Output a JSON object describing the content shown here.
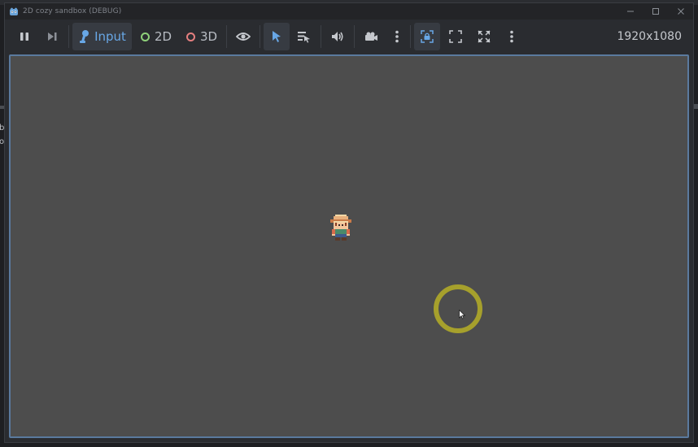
{
  "window": {
    "title": "2D cozy sandbox (DEBUG)"
  },
  "backdrop": {
    "left_chars": [
      "b",
      "o"
    ]
  },
  "toolbar": {
    "input_label": "Input",
    "mode_2d_label": "2D",
    "mode_3d_label": "3D",
    "resolution": "1920x1080"
  },
  "colors": {
    "accent_blue": "#68a7e6",
    "ring_2d": "#8fd07a",
    "ring_3d": "#e57f7f",
    "viewport_bg": "#4d4d4d",
    "target_ring": "#a6a02c"
  },
  "icons": {
    "pause": "pause-icon",
    "step": "step-frame-icon",
    "input": "input-joystick-icon",
    "visibility": "eye-icon",
    "select": "select-arrow-icon",
    "list_select": "list-select-icon",
    "audio": "speaker-icon",
    "camera": "camera-icon",
    "more": "vertical-dots-icon",
    "lock_camera": "camera-lock-icon",
    "fit": "fit-expand-icon",
    "fullscreen": "fullscreen-icon"
  }
}
